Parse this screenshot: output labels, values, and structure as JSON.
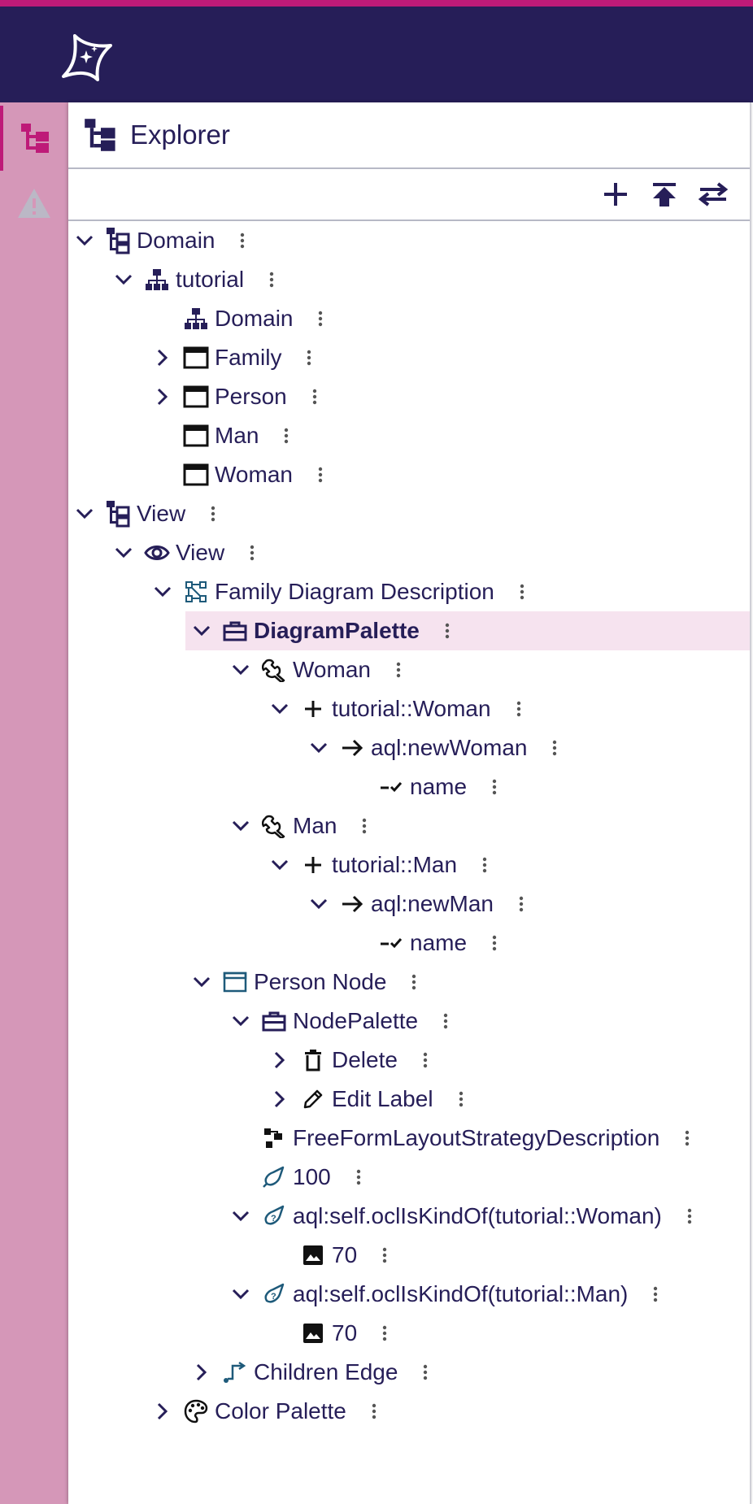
{
  "explorer": {
    "title": "Explorer"
  },
  "tree": [
    {
      "label": "Domain",
      "icon": "tree-icon",
      "chevron": "down",
      "indent": 0
    },
    {
      "label": "tutorial",
      "icon": "hierarchy-icon",
      "chevron": "down",
      "indent": 1
    },
    {
      "label": "Domain",
      "icon": "hierarchy-icon",
      "chevron": "none",
      "indent": 2
    },
    {
      "label": "Family",
      "icon": "window-icon",
      "chevron": "right",
      "indent": 2
    },
    {
      "label": "Person",
      "icon": "window-icon",
      "chevron": "right",
      "indent": 2
    },
    {
      "label": "Man",
      "icon": "window-icon",
      "chevron": "none",
      "indent": 2
    },
    {
      "label": "Woman",
      "icon": "window-icon",
      "chevron": "none",
      "indent": 2
    },
    {
      "label": "View",
      "icon": "tree-icon",
      "chevron": "down",
      "indent": 0
    },
    {
      "label": "View",
      "icon": "eye-icon",
      "chevron": "down",
      "indent": 1
    },
    {
      "label": "Family Diagram Description",
      "icon": "diagram-icon",
      "chevron": "down",
      "indent": 2
    },
    {
      "label": "DiagramPalette",
      "icon": "toolbox-icon",
      "chevron": "down",
      "indent": 3,
      "selected": true
    },
    {
      "label": "Woman",
      "icon": "wrench-icon",
      "chevron": "down",
      "indent": 4
    },
    {
      "label": "tutorial::Woman",
      "icon": "plus-icon",
      "chevron": "down",
      "indent": 5
    },
    {
      "label": "aql:newWoman",
      "icon": "arrow-right-icon",
      "chevron": "down",
      "indent": 6
    },
    {
      "label": "name",
      "icon": "set-value-icon",
      "chevron": "none",
      "indent": 7
    },
    {
      "label": "Man",
      "icon": "wrench-icon",
      "chevron": "down",
      "indent": 4
    },
    {
      "label": "tutorial::Man",
      "icon": "plus-icon",
      "chevron": "down",
      "indent": 5
    },
    {
      "label": "aql:newMan",
      "icon": "arrow-right-icon",
      "chevron": "down",
      "indent": 6
    },
    {
      "label": "name",
      "icon": "set-value-icon",
      "chevron": "none",
      "indent": 7
    },
    {
      "label": "Person Node",
      "icon": "node-icon",
      "chevron": "down",
      "indent": 3
    },
    {
      "label": "NodePalette",
      "icon": "toolbox-icon",
      "chevron": "down",
      "indent": 4
    },
    {
      "label": "Delete",
      "icon": "trash-icon",
      "chevron": "right",
      "indent": 5
    },
    {
      "label": "Edit Label",
      "icon": "pencil-icon",
      "chevron": "right",
      "indent": 5
    },
    {
      "label": "FreeFormLayoutStrategyDescription",
      "icon": "layout-icon",
      "chevron": "none",
      "indent": 4
    },
    {
      "label": "100",
      "icon": "style-icon",
      "chevron": "none",
      "indent": 4
    },
    {
      "label": "aql:self.oclIsKindOf(tutorial::Woman)",
      "icon": "conditional-style-icon",
      "chevron": "down",
      "indent": 4
    },
    {
      "label": "70",
      "icon": "image-icon",
      "chevron": "none",
      "indent": 5
    },
    {
      "label": "aql:self.oclIsKindOf(tutorial::Man)",
      "icon": "conditional-style-icon",
      "chevron": "down",
      "indent": 4
    },
    {
      "label": "70",
      "icon": "image-icon",
      "chevron": "none",
      "indent": 5
    },
    {
      "label": "Children Edge",
      "icon": "edge-icon",
      "chevron": "right",
      "indent": 3
    },
    {
      "label": "Color Palette",
      "icon": "palette-icon",
      "chevron": "right",
      "indent": 2
    }
  ],
  "colors": {
    "topbar": "#261E58",
    "accent": "#BE1A78",
    "rail": "#D597B8",
    "selected": "#F6E3EF",
    "text": "#261E58"
  }
}
